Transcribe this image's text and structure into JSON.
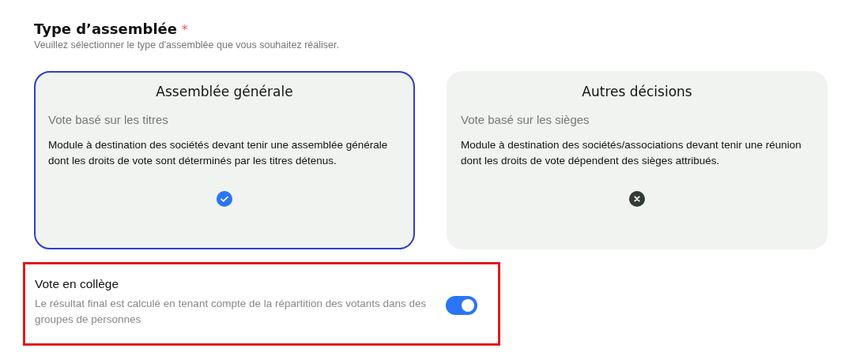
{
  "section": {
    "title": "Type d’assemblée",
    "required_mark": "*",
    "hint": "Veuillez sélectionner le type d'assemblée que vous souhaitez réaliser."
  },
  "options": [
    {
      "title": "Assemblée générale",
      "subtitle": "Vote basé sur les titres",
      "description": "Module à destination des sociétés devant tenir une assemblée générale dont les droits de vote sont déterminés par les titres détenus.",
      "selected": true
    },
    {
      "title": "Autres décisions",
      "subtitle": "Vote basé sur les sièges",
      "description": "Module à destination des sociétés/associations devant tenir une réunion dont les droits de vote dépendent des sièges attribués.",
      "selected": false
    }
  ],
  "setting": {
    "title": "Vote en collège",
    "description": "Le résultat final est calculé en tenant compte de la répartition des votants dans des groupes de personnes",
    "on": true,
    "highlighted": true
  }
}
